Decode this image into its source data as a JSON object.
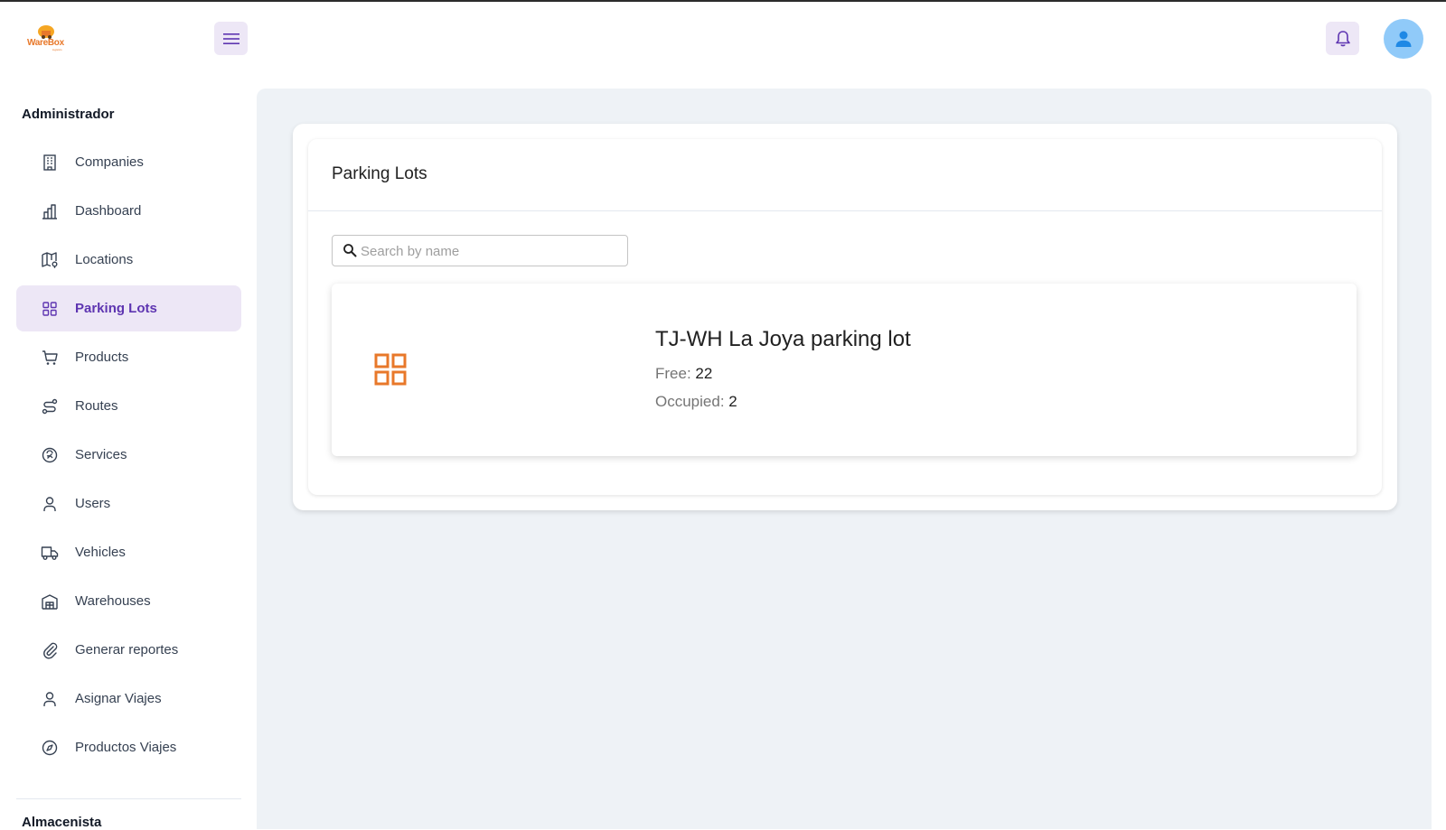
{
  "app": {
    "logo_text": "WareBox",
    "logo_sub": "logistics"
  },
  "header": {
    "menu_icon": "hamburger-menu-icon",
    "notification_icon": "bell-icon",
    "avatar_icon": "user-icon"
  },
  "sidebar": {
    "section_title": "Administrador",
    "items": [
      {
        "label": "Companies",
        "icon": "building-icon"
      },
      {
        "label": "Dashboard",
        "icon": "bar-chart-icon"
      },
      {
        "label": "Locations",
        "icon": "map-pin-icon"
      },
      {
        "label": "Parking Lots",
        "icon": "grid-icon",
        "active": true
      },
      {
        "label": "Products",
        "icon": "shopping-cart-icon"
      },
      {
        "label": "Routes",
        "icon": "route-icon"
      },
      {
        "label": "Services",
        "icon": "service-icon"
      },
      {
        "label": "Users",
        "icon": "user-icon"
      },
      {
        "label": "Vehicles",
        "icon": "truck-icon"
      },
      {
        "label": "Warehouses",
        "icon": "warehouse-icon"
      },
      {
        "label": "Generar reportes",
        "icon": "paperclip-icon"
      },
      {
        "label": "Asignar Viajes",
        "icon": "user-icon"
      },
      {
        "label": "Productos Viajes",
        "icon": "compass-icon"
      }
    ],
    "next_section_title": "Almacenista"
  },
  "main": {
    "title": "Parking Lots",
    "search": {
      "placeholder": "Search by name",
      "value": ""
    },
    "lots": [
      {
        "name": "TJ-WH La Joya parking lot",
        "free_label": "Free:",
        "free_value": "22",
        "occupied_label": "Occupied:",
        "occupied_value": "2",
        "icon": "grid-icon"
      }
    ]
  },
  "colors": {
    "accent": "#5e35b1",
    "accent_bg": "#ede7f6",
    "active_bar": "#2196f3",
    "lot_icon": "#e8782a",
    "main_bg": "#eef2f6",
    "avatar_bg": "#90caf9"
  }
}
